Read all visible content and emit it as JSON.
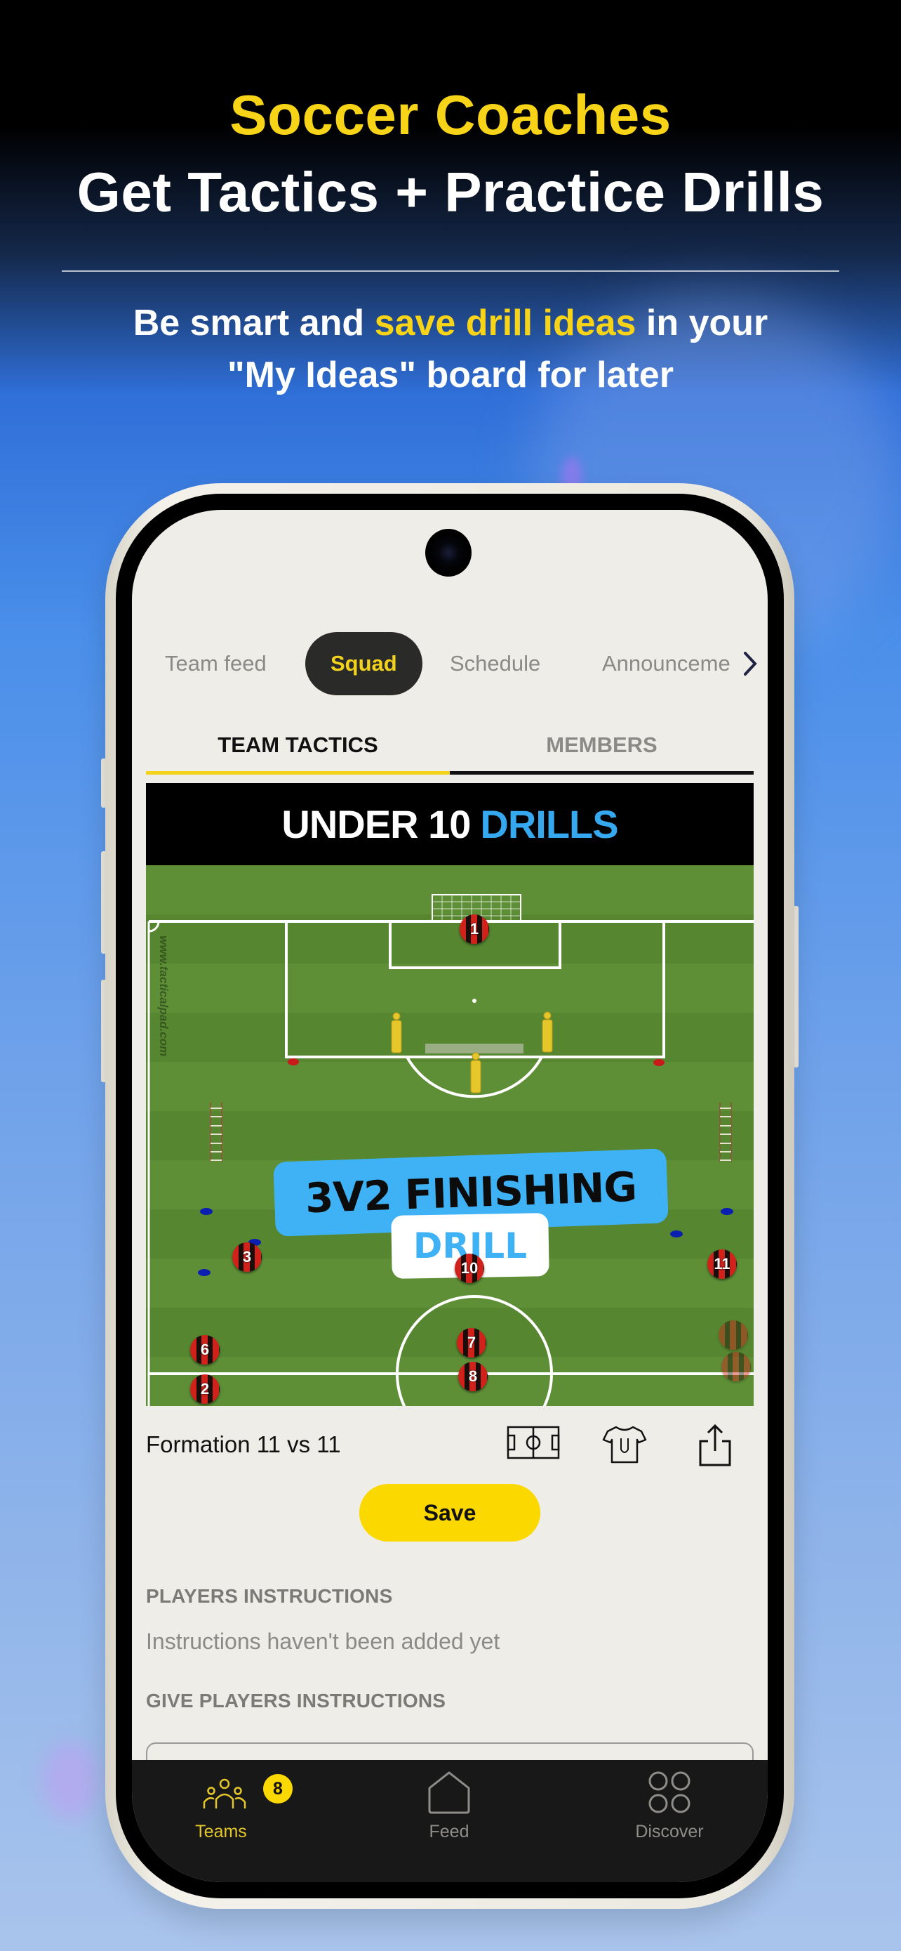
{
  "hero": {
    "title_line1": "Soccer Coaches",
    "title_line2": "Get Tactics + Practice Drills",
    "subtitle_part1": "Be smart and ",
    "subtitle_highlight": "save drill ideas",
    "subtitle_part2": " in your",
    "subtitle_line2": "\"My Ideas\" board for later"
  },
  "colors": {
    "accent_yellow": "#f7d417",
    "drill_blue": "#36a8f0",
    "nav_bg": "#181818",
    "screen_bg": "#efede8"
  },
  "top_tabs": [
    {
      "label": "Team feed",
      "active": false
    },
    {
      "label": "Squad",
      "active": true
    },
    {
      "label": "Schedule",
      "active": false
    },
    {
      "label": "Announceme",
      "active": false
    }
  ],
  "sub_tabs": [
    {
      "label": "TEAM TACTICS",
      "active": true
    },
    {
      "label": "MEMBERS",
      "active": false
    }
  ],
  "drill": {
    "header_white": "UNDER 10",
    "header_blue": "DRILLS",
    "title": "3V2 FINISHING",
    "subtitle": "DRILL",
    "watermark": "www.tacticalpad.com",
    "players": [
      "1",
      "3",
      "10",
      "11",
      "6",
      "7",
      "8",
      "2"
    ]
  },
  "formation": {
    "label": "Formation 11 vs 11",
    "icons": [
      "pitch-icon",
      "jersey-icon",
      "share-icon"
    ]
  },
  "save_button": "Save",
  "instructions": {
    "section_title": "PLAYERS INSTRUCTIONS",
    "empty_text": "Instructions haven't been added yet",
    "give_title": "GIVE PLAYERS INSTRUCTIONS"
  },
  "bottom_nav": [
    {
      "label": "Teams",
      "icon": "team-icon",
      "active": true,
      "badge": "8"
    },
    {
      "label": "Feed",
      "icon": "home-icon",
      "active": false
    },
    {
      "label": "Discover",
      "icon": "grid-icon",
      "active": false
    }
  ]
}
